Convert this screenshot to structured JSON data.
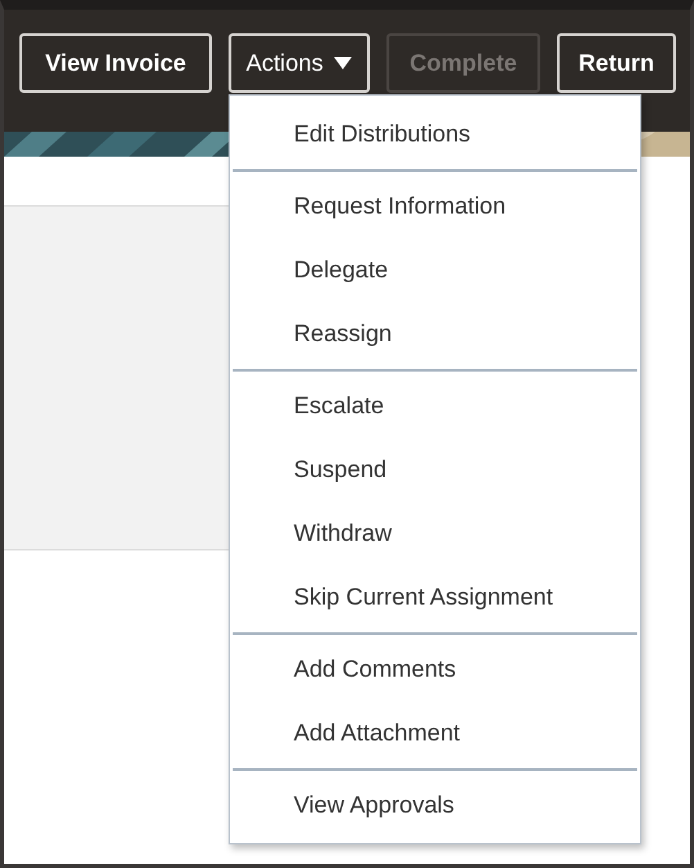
{
  "toolbar": {
    "buttons": [
      {
        "label": "View Invoice",
        "kind": "button",
        "disabled": false
      },
      {
        "label": "Actions",
        "kind": "menu",
        "disabled": false,
        "expanded": true
      },
      {
        "label": "Complete",
        "kind": "button",
        "disabled": true
      },
      {
        "label": "Return",
        "kind": "button",
        "disabled": false
      }
    ]
  },
  "actions_menu": {
    "groups": [
      {
        "items": [
          "Edit Distributions"
        ]
      },
      {
        "items": [
          "Request Information",
          "Delegate",
          "Reassign"
        ]
      },
      {
        "items": [
          "Escalate",
          "Suspend",
          "Withdraw",
          "Skip Current Assignment"
        ]
      },
      {
        "items": [
          "Add Comments",
          "Add Attachment"
        ]
      },
      {
        "items": [
          "View Approvals"
        ]
      }
    ]
  }
}
